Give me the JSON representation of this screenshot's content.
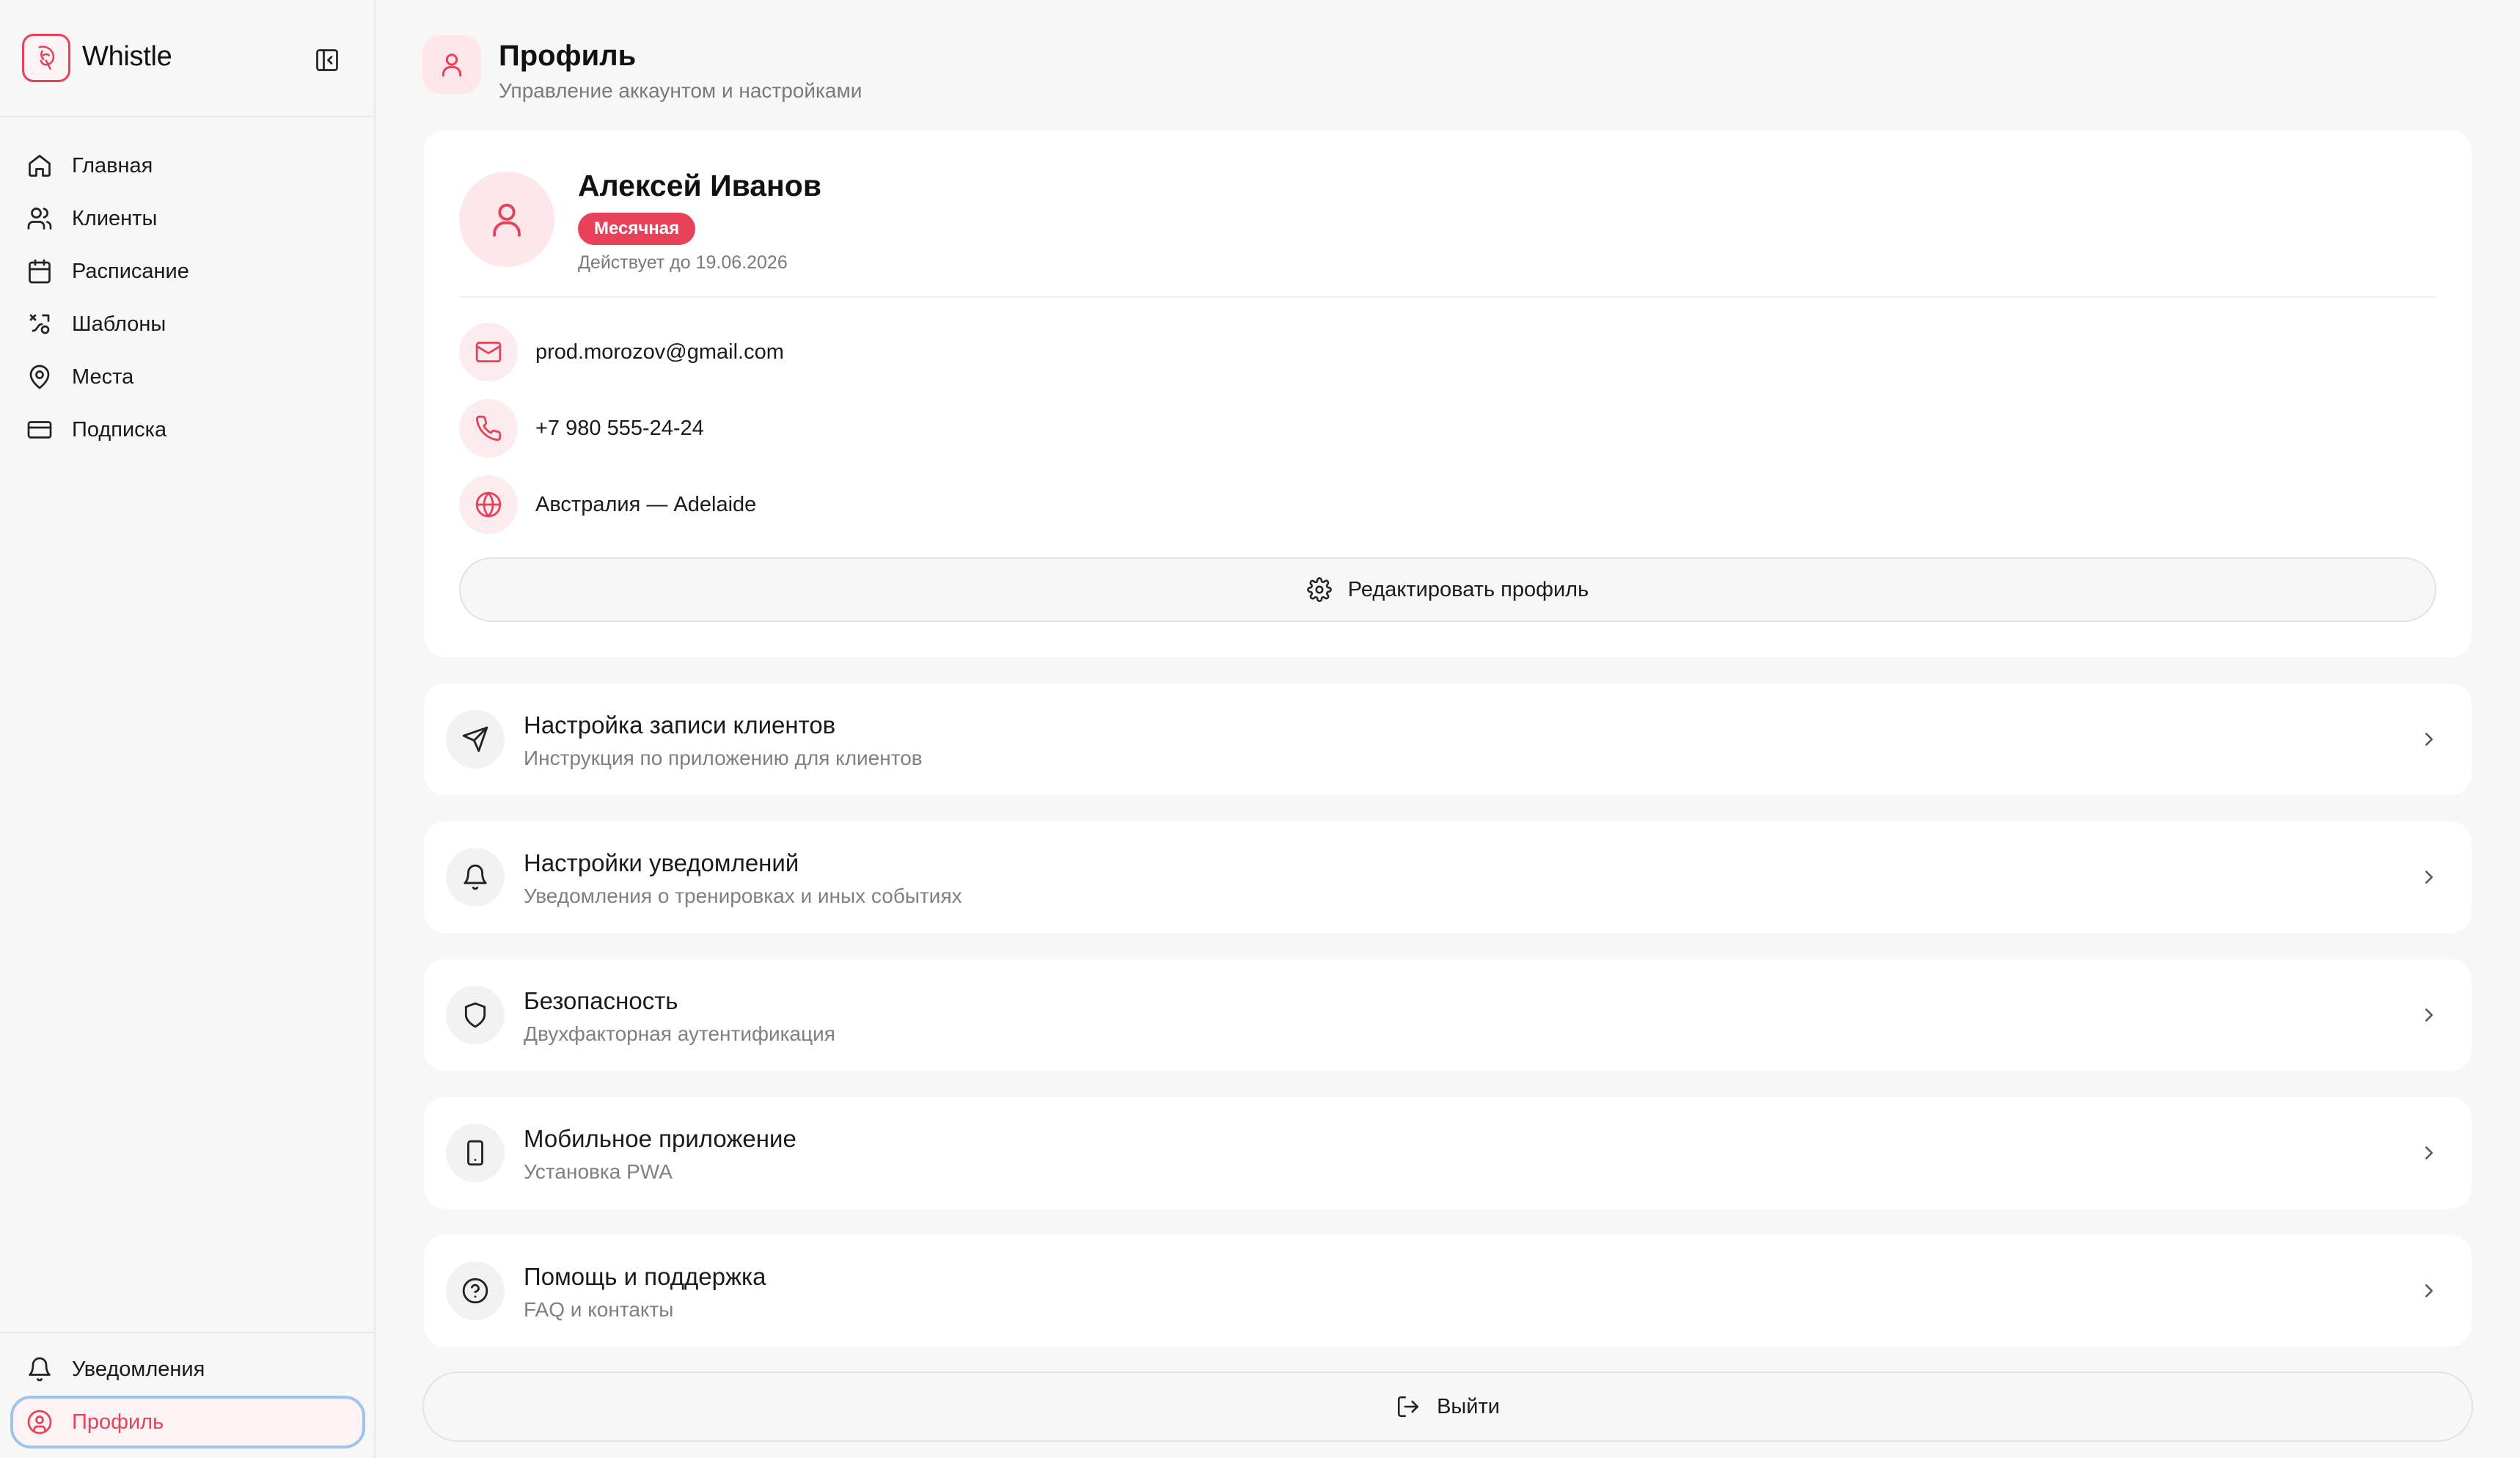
{
  "app": {
    "name": "Whistle"
  },
  "sidebar": {
    "items": [
      {
        "label": "Главная",
        "icon": "home-icon"
      },
      {
        "label": "Клиенты",
        "icon": "users-icon"
      },
      {
        "label": "Расписание",
        "icon": "calendar-icon"
      },
      {
        "label": "Шаблоны",
        "icon": "templates-icon"
      },
      {
        "label": "Места",
        "icon": "map-pin-icon"
      },
      {
        "label": "Подписка",
        "icon": "credit-card-icon"
      }
    ],
    "bottom": [
      {
        "label": "Уведомления",
        "icon": "bell-icon"
      },
      {
        "label": "Профиль",
        "icon": "user-circle-icon",
        "active": true
      }
    ]
  },
  "header": {
    "title": "Профиль",
    "subtitle": "Управление аккаунтом и настройками"
  },
  "profile": {
    "name": "Алексей Иванов",
    "plan": "Месячная",
    "valid_until": "Действует до 19.06.2026",
    "email": "prod.morozov@gmail.com",
    "phone": "+7 980 555-24-24",
    "location": "Австралия — Adelaide",
    "edit_label": "Редактировать профиль"
  },
  "menu": [
    {
      "title": "Настройка записи клиентов",
      "subtitle": "Инструкция по приложению для клиентов",
      "icon": "send-icon"
    },
    {
      "title": "Настройки уведомлений",
      "subtitle": "Уведомления о тренировках и иных событиях",
      "icon": "bell-icon"
    },
    {
      "title": "Безопасность",
      "subtitle": "Двухфакторная аутентификация",
      "icon": "shield-icon"
    },
    {
      "title": "Мобильное приложение",
      "subtitle": "Установка PWA",
      "icon": "smartphone-icon"
    },
    {
      "title": "Помощь и поддержка",
      "subtitle": "FAQ и контакты",
      "icon": "help-circle-icon"
    }
  ],
  "logout_label": "Выйти",
  "colors": {
    "accent": "#e8415a",
    "accent_soft": "#fde7eb",
    "background": "#f7f7f7",
    "card": "#ffffff",
    "active_outline": "#9cc4ec"
  }
}
